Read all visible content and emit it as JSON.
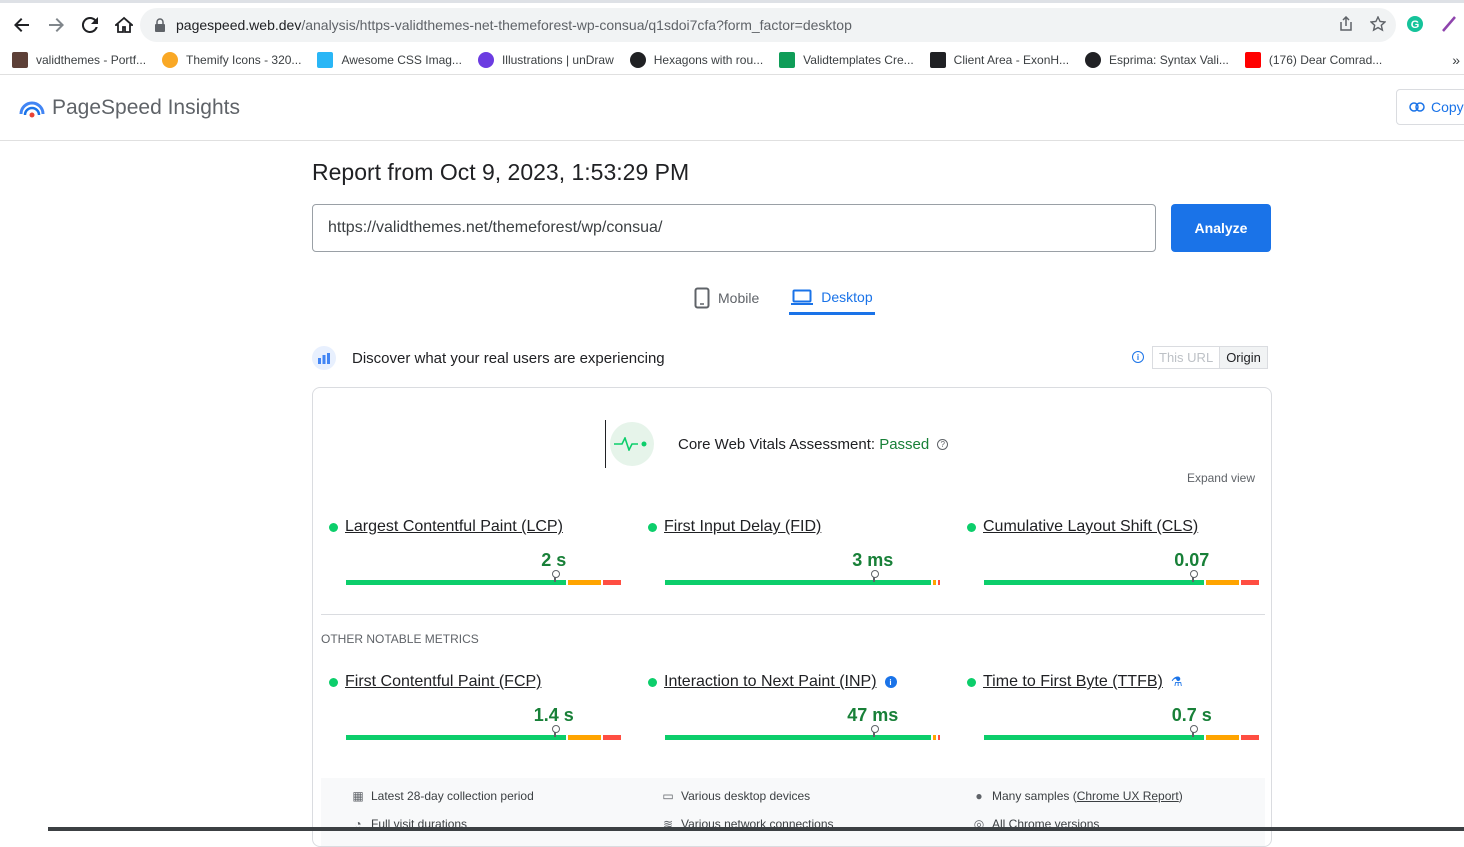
{
  "browser": {
    "url_host": "pagespeed.web.dev",
    "url_path": "/analysis/https-validthemes-net-themeforest-wp-consua/q1sdoi7cfa?form_factor=desktop",
    "bookmarks": [
      {
        "label": "validthemes - Portf...",
        "icon": "photo-icon",
        "color": "#5d4037"
      },
      {
        "label": "Themify Icons - 320...",
        "icon": "smiley-icon",
        "color": "#f9a825"
      },
      {
        "label": "Awesome CSS Imag...",
        "icon": "puzzle-icon",
        "color": "#29b6f6"
      },
      {
        "label": "Illustrations | unDraw",
        "icon": "undraw-icon",
        "color": "#6c3ce1"
      },
      {
        "label": "Hexagons with rou...",
        "icon": "codepen-icon",
        "color": "#202124"
      },
      {
        "label": "Validtemplates Cre...",
        "icon": "sheets-icon",
        "color": "#0f9d58"
      },
      {
        "label": "Client Area - ExonH...",
        "icon": "grid-icon",
        "color": "#202124"
      },
      {
        "label": "Esprima: Syntax Vali...",
        "icon": "esprima-icon",
        "color": "#202124"
      },
      {
        "label": "(176) Dear Comrad...",
        "icon": "youtube-icon",
        "color": "#ff0000"
      }
    ]
  },
  "header": {
    "title": "PageSpeed Insights",
    "copy_label": "Copy"
  },
  "report": {
    "title": "Report from Oct 9, 2023, 1:53:29 PM",
    "url_value": "https://validthemes.net/themeforest/wp/consua/",
    "analyze_label": "Analyze"
  },
  "tabs": [
    {
      "label": "Mobile",
      "active": false
    },
    {
      "label": "Desktop",
      "active": true
    }
  ],
  "discover": {
    "text": "Discover what your real users are experiencing",
    "this_url": "This URL",
    "origin": "Origin"
  },
  "cwv": {
    "label": "Core Web Vitals Assessment:",
    "status": "Passed",
    "expand": "Expand view"
  },
  "metrics": [
    {
      "name": "Largest Contentful Paint (LCP)",
      "value": "2 s",
      "position": 0.75,
      "status_color": "#0cce6b"
    },
    {
      "name": "First Input Delay (FID)",
      "value": "3 ms",
      "position": 0.75,
      "status_color": "#0cce6b"
    },
    {
      "name": "Cumulative Layout Shift (CLS)",
      "value": "0.07",
      "position": 0.75,
      "status_color": "#0cce6b"
    }
  ],
  "other_title": "OTHER NOTABLE METRICS",
  "other_metrics": [
    {
      "name": "First Contentful Paint (FCP)",
      "value": "1.4 s",
      "position": 0.75
    },
    {
      "name": "Interaction to Next Paint (INP)",
      "value": "47 ms",
      "position": 0.75
    },
    {
      "name": "Time to First Byte (TTFB)",
      "value": "0.7 s",
      "position": 0.75
    }
  ],
  "info": {
    "collection": "Latest 28-day collection period",
    "devices": "Various desktop devices",
    "samples_prefix": "Many samples (",
    "samples_link": "Chrome UX Report",
    "samples_suffix": ")",
    "durations": "Full visit durations",
    "network": "Various network connections",
    "chrome": "All Chrome versions"
  },
  "colors": {
    "good": "#0cce6b",
    "needs_improvement": "#ffa400",
    "poor": "#ff4e42",
    "accent": "#1a73e8"
  }
}
